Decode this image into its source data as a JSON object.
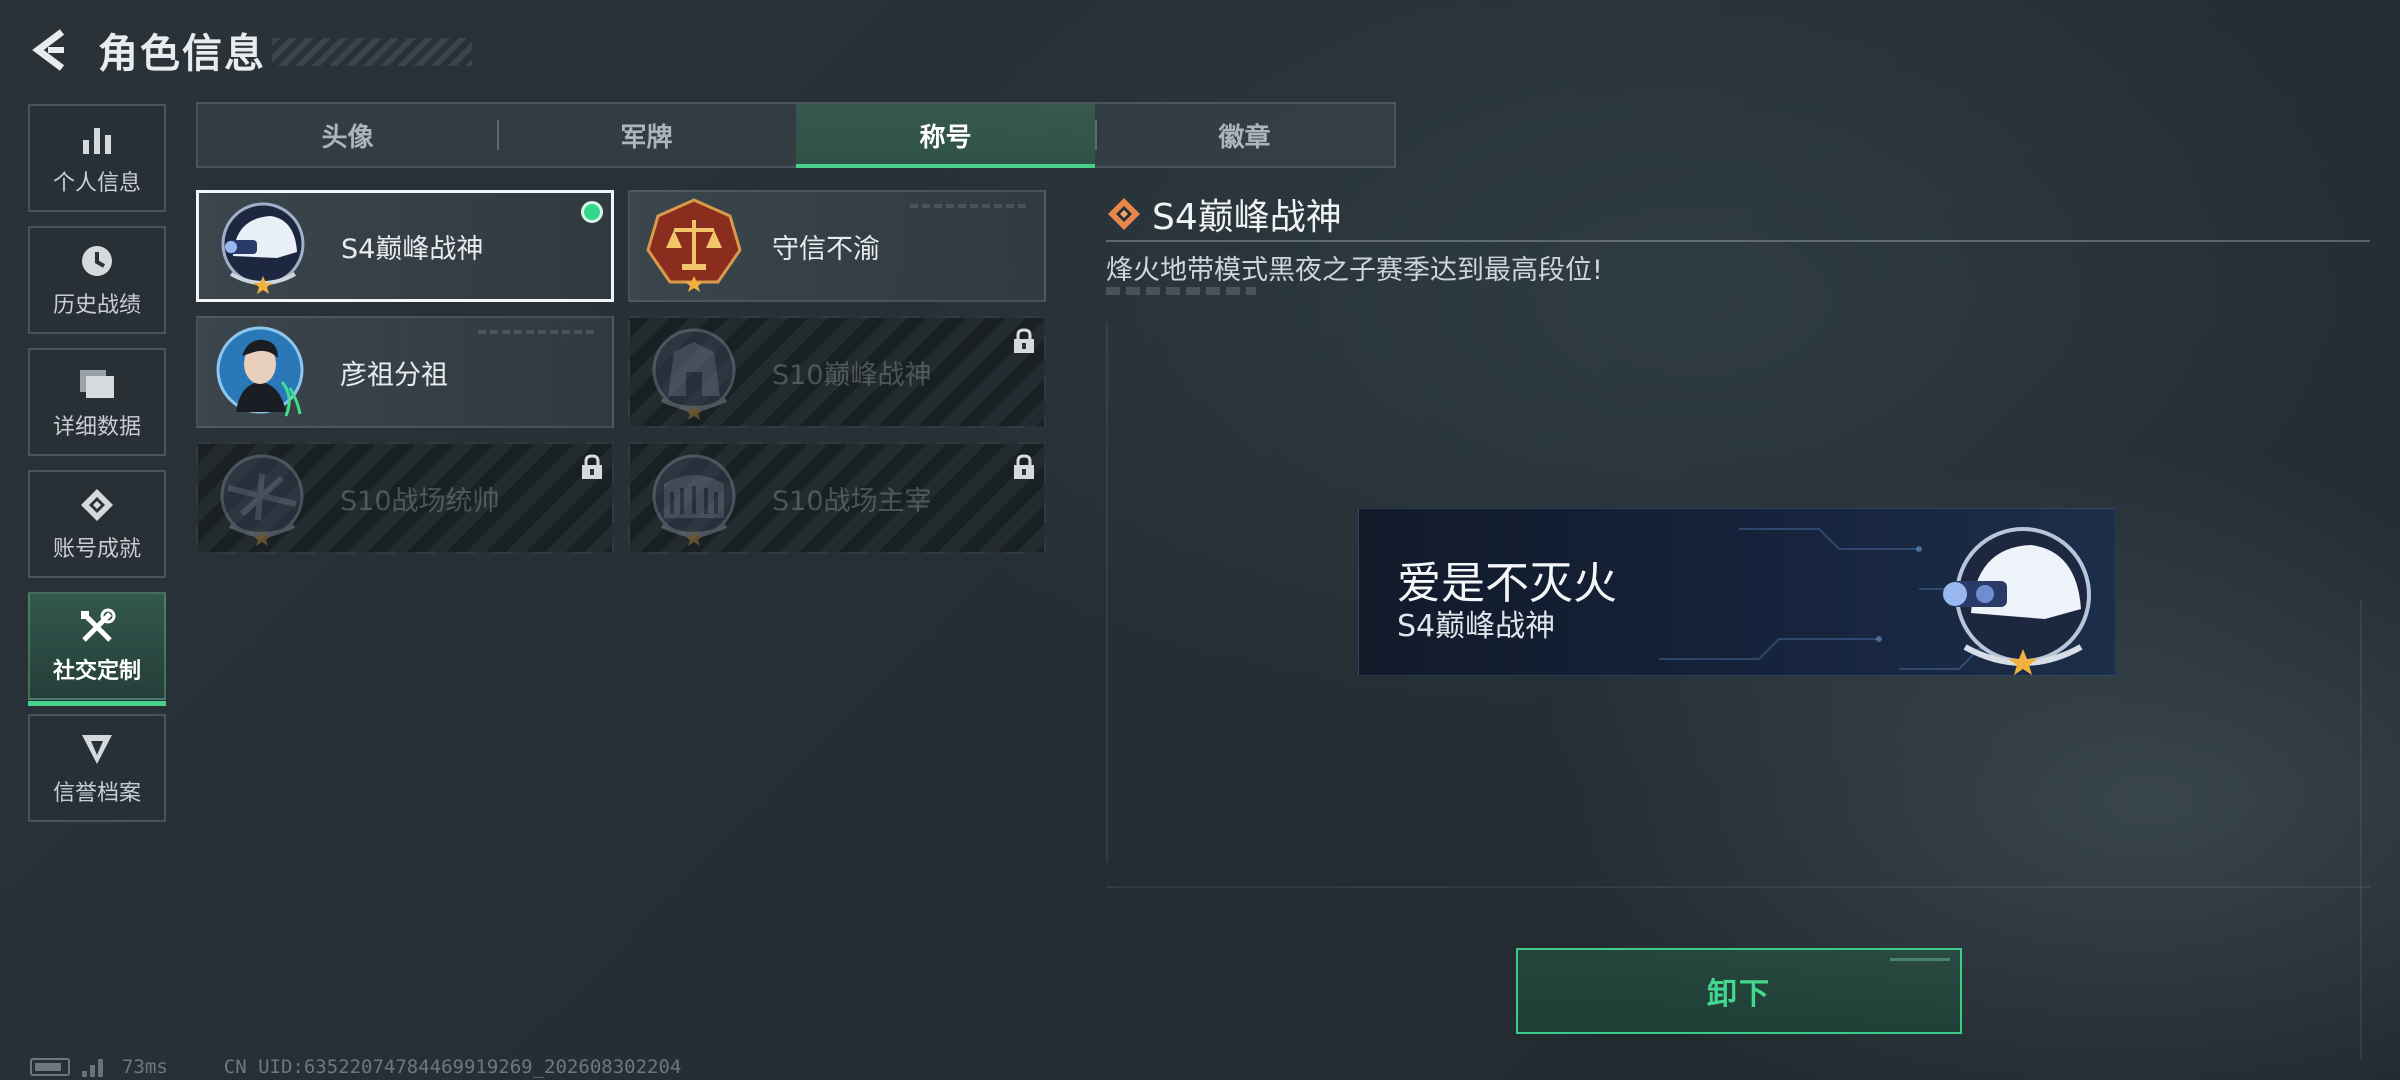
{
  "header": {
    "title": "角色信息"
  },
  "sidebar": {
    "items": [
      {
        "label": "个人信息",
        "icon": "bar-chart-icon",
        "active": false
      },
      {
        "label": "历史战绩",
        "icon": "clock-icon",
        "active": false
      },
      {
        "label": "详细数据",
        "icon": "folder-icon",
        "active": false
      },
      {
        "label": "账号成就",
        "icon": "achievement-icon",
        "active": false
      },
      {
        "label": "社交定制",
        "icon": "tools-icon",
        "active": true
      },
      {
        "label": "信誉档案",
        "icon": "shield-icon",
        "active": false
      }
    ]
  },
  "tabs": [
    {
      "label": "头像",
      "active": false
    },
    {
      "label": "军牌",
      "active": false
    },
    {
      "label": "称号",
      "active": true
    },
    {
      "label": "徽章",
      "active": false
    }
  ],
  "titles": [
    {
      "name": "S4巅峰战神",
      "icon": "helmet-badge-icon",
      "selected": true,
      "equipped": true,
      "locked": false
    },
    {
      "name": "守信不渝",
      "icon": "scales-badge-icon",
      "selected": false,
      "equipped": false,
      "locked": false
    },
    {
      "name": "彦祖分祖",
      "icon": "portrait-badge-icon",
      "selected": false,
      "equipped": false,
      "locked": false
    },
    {
      "name": "S10巅峰战神",
      "icon": "building-badge-icon",
      "selected": false,
      "equipped": false,
      "locked": true
    },
    {
      "name": "S10战场统帅",
      "icon": "aircraft-badge-icon",
      "selected": false,
      "equipped": false,
      "locked": true
    },
    {
      "name": "S10战场主宰",
      "icon": "colosseum-badge-icon",
      "selected": false,
      "equipped": false,
      "locked": true
    }
  ],
  "detail": {
    "title": "S4巅峰战神",
    "description": "烽火地带模式黑夜之子赛季达到最高段位!"
  },
  "preview": {
    "nickname": "爱是不灭火",
    "title": "S4巅峰战神"
  },
  "actions": {
    "unequip_label": "卸下"
  },
  "status": {
    "ping": "73ms",
    "uid": "CN UID:6352207478446991926​9_202608302204"
  },
  "colors": {
    "accent": "#47d18c",
    "background": "#253036",
    "equipped_dot": "#35d58a",
    "detail_diamond": "#e7874a"
  }
}
